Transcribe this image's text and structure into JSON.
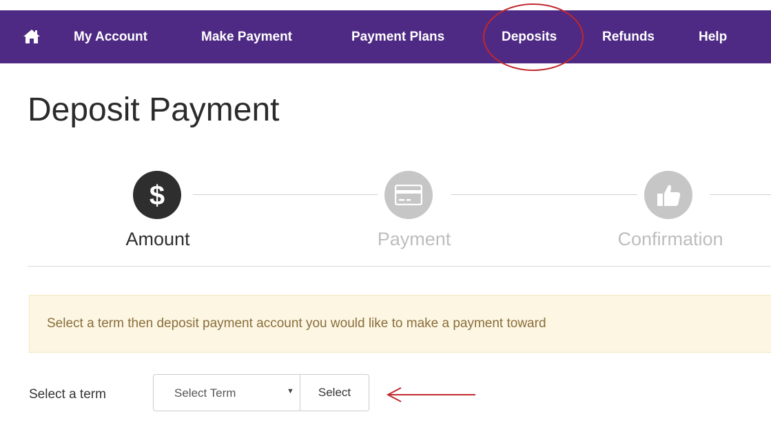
{
  "nav": {
    "home_icon": "home-icon",
    "items": [
      {
        "label": "My Account"
      },
      {
        "label": "Make Payment"
      },
      {
        "label": "Payment Plans"
      },
      {
        "label": "Deposits"
      },
      {
        "label": "Refunds"
      },
      {
        "label": "Help"
      }
    ],
    "background_color": "#4e2a84",
    "highlighted_item": "Deposits"
  },
  "page": {
    "title": "Deposit Payment"
  },
  "steps": [
    {
      "label": "Amount",
      "icon": "dollar-icon",
      "state": "active"
    },
    {
      "label": "Payment",
      "icon": "credit-card-icon",
      "state": "inactive"
    },
    {
      "label": "Confirmation",
      "icon": "thumbs-up-icon",
      "state": "inactive"
    }
  ],
  "alert": {
    "text": "Select a term then deposit payment account you would like to make a payment toward",
    "background_color": "#fcf6e3"
  },
  "term_form": {
    "label": "Select a term",
    "select_value": "Select Term",
    "button_label": "Select"
  },
  "annotations": {
    "color": "#c0282d"
  }
}
